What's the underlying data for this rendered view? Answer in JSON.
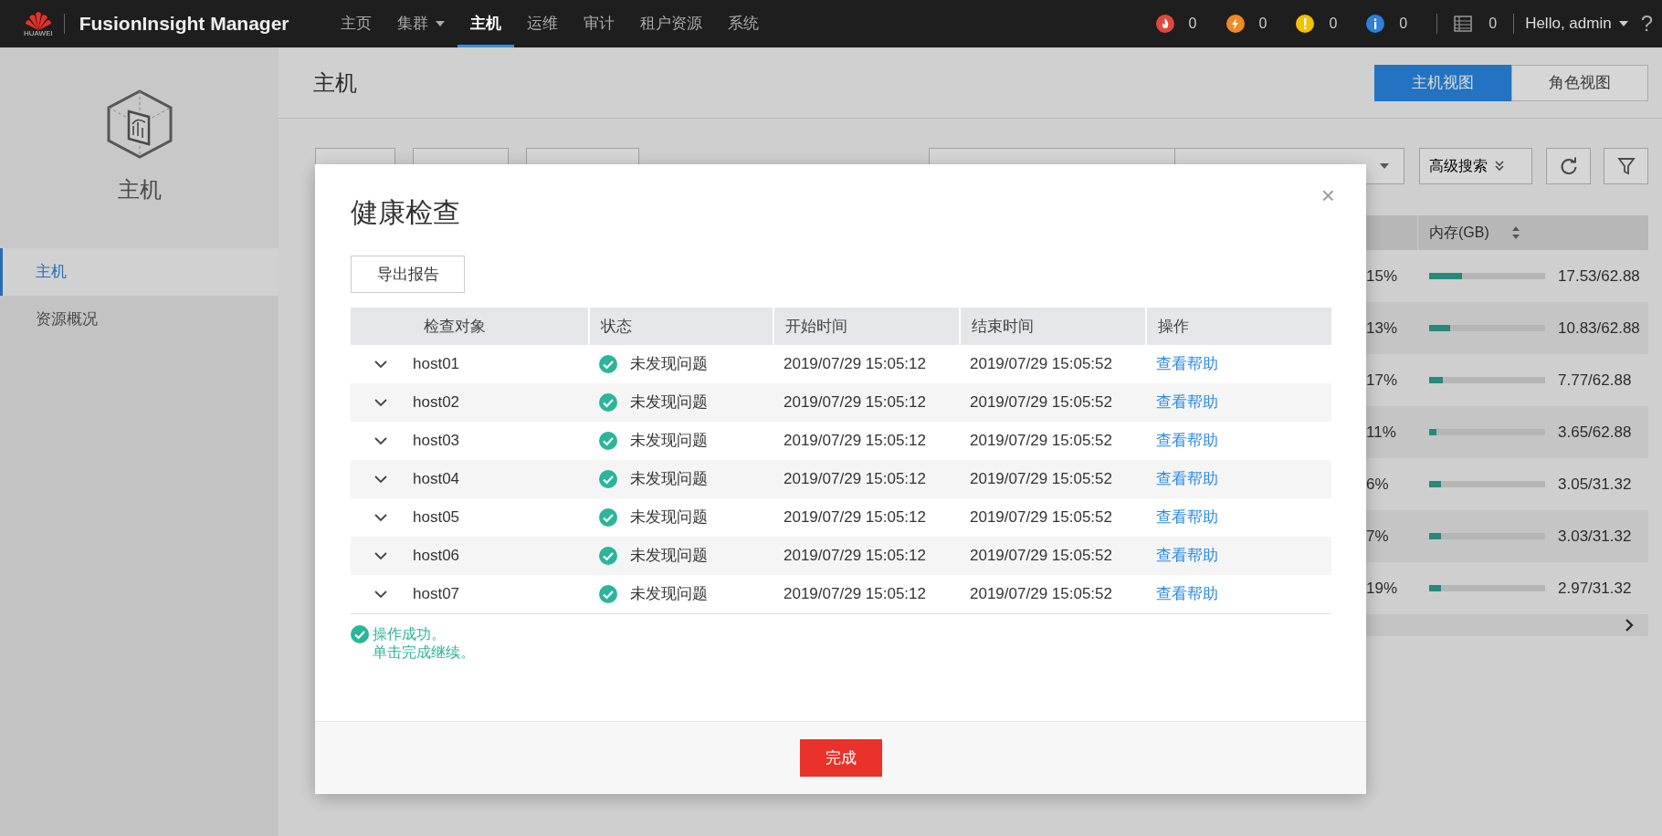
{
  "top_bar": {
    "logo_caption": "HUAWEI",
    "brand": "FusionInsight Manager",
    "nav": [
      {
        "label": "主页",
        "selected": false,
        "dropdown": false
      },
      {
        "label": "集群",
        "selected": false,
        "dropdown": true
      },
      {
        "label": "主机",
        "selected": true,
        "dropdown": false
      },
      {
        "label": "运维",
        "selected": false,
        "dropdown": false
      },
      {
        "label": "审计",
        "selected": false,
        "dropdown": false
      },
      {
        "label": "租户资源",
        "selected": false,
        "dropdown": false
      },
      {
        "label": "系统",
        "selected": false,
        "dropdown": false
      }
    ],
    "alarms": [
      {
        "kind": "critical",
        "color": "#e0483e",
        "count": "0"
      },
      {
        "kind": "major",
        "color": "#ef8a25",
        "count": "0"
      },
      {
        "kind": "minor",
        "color": "#f2c200",
        "count": "0"
      },
      {
        "kind": "warning",
        "color": "#2f80d8",
        "count": "0"
      }
    ],
    "tasks_count": "0",
    "user": "Hello, admin",
    "help": "?"
  },
  "sidebar": {
    "title": "主机",
    "items": [
      {
        "label": "主机",
        "selected": true
      },
      {
        "label": "资源概况",
        "selected": false
      }
    ]
  },
  "page": {
    "title": "主机",
    "view_tabs": [
      {
        "label": "主机视图",
        "selected": true
      },
      {
        "label": "角色视图",
        "selected": false
      }
    ],
    "advanced_search": "高级搜索",
    "table": {
      "memory_header": "内存(GB)",
      "rows": [
        {
          "cpu": "15%",
          "level": 0.28,
          "memory": "17.53/62.88"
        },
        {
          "cpu": "13%",
          "level": 0.18,
          "memory": "10.83/62.88"
        },
        {
          "cpu": "17%",
          "level": 0.12,
          "memory": "7.77/62.88"
        },
        {
          "cpu": "11%",
          "level": 0.06,
          "memory": "3.65/62.88"
        },
        {
          "cpu": "6%",
          "level": 0.1,
          "memory": "3.05/31.32"
        },
        {
          "cpu": "7%",
          "level": 0.1,
          "memory": "3.03/31.32"
        },
        {
          "cpu": "19%",
          "level": 0.1,
          "memory": "2.97/31.32"
        }
      ]
    }
  },
  "dialog": {
    "title": "健康检查",
    "close": "×",
    "export_button": "导出报告",
    "columns": [
      "检查对象",
      "状态",
      "开始时间",
      "结束时间",
      "操作"
    ],
    "rows": [
      {
        "name": "host01",
        "expanded": false,
        "status_ok": true,
        "status": "未发现问题",
        "start": "2019/07/29 15:05:12",
        "end": "2019/07/29 15:05:52",
        "action": "查看帮助"
      },
      {
        "name": "host02",
        "expanded": false,
        "status_ok": true,
        "status": "未发现问题",
        "start": "2019/07/29 15:05:12",
        "end": "2019/07/29 15:05:52",
        "action": "查看帮助"
      },
      {
        "name": "host03",
        "expanded": false,
        "status_ok": true,
        "status": "未发现问题",
        "start": "2019/07/29 15:05:12",
        "end": "2019/07/29 15:05:52",
        "action": "查看帮助"
      },
      {
        "name": "host04",
        "expanded": false,
        "status_ok": true,
        "status": "未发现问题",
        "start": "2019/07/29 15:05:12",
        "end": "2019/07/29 15:05:52",
        "action": "查看帮助"
      },
      {
        "name": "host05",
        "expanded": false,
        "status_ok": true,
        "status": "未发现问题",
        "start": "2019/07/29 15:05:12",
        "end": "2019/07/29 15:05:52",
        "action": "查看帮助"
      },
      {
        "name": "host06",
        "expanded": false,
        "status_ok": true,
        "status": "未发现问题",
        "start": "2019/07/29 15:05:12",
        "end": "2019/07/29 15:05:52",
        "action": "查看帮助"
      },
      {
        "name": "host07",
        "expanded": false,
        "status_ok": true,
        "status": "未发现问题",
        "start": "2019/07/29 15:05:12",
        "end": "2019/07/29 15:05:52",
        "action": "查看帮助"
      }
    ],
    "message": [
      "操作成功。",
      "单击完成继续。"
    ],
    "done_button": "完成"
  }
}
